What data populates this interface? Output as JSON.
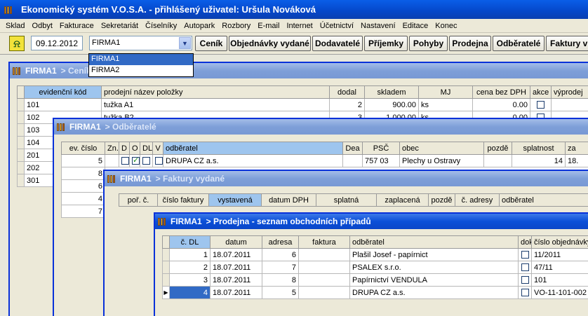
{
  "app": {
    "title": "Ekonomický systém V.O.S.A. - přihlášený uživatel: Uršula Nováková"
  },
  "menu": [
    "Sklad",
    "Odbyt",
    "Fakturace",
    "Sekretariát",
    "Číselníky",
    "Autopark",
    "Rozbory",
    "E-mail",
    "Internet",
    "Účetnictví",
    "Nastavení",
    "Editace",
    "Konec"
  ],
  "toolbar": {
    "date": "09.12.2012",
    "company_selected": "FIRMA1",
    "company_options": [
      "FIRMA1",
      "FIRMA2"
    ],
    "buttons": [
      "Ceník",
      "Objednávky vydané",
      "Dodavatelé",
      "Příjemky",
      "Pohyby",
      "Prodejna",
      "Odběratelé",
      "Faktury v"
    ]
  },
  "win_cenik": {
    "title": "FIRMA1",
    "crumb": "> Ceník",
    "columns": [
      "evidenční kód",
      "prodejní název položky",
      "dodal",
      "skladem",
      "MJ",
      "cena bez DPH",
      "akce",
      "výprodej"
    ],
    "rows": [
      {
        "code": "101",
        "name": "tužka A1",
        "dodal": "2",
        "skladem": "900.00",
        "mj": "ks",
        "cena": "0.00"
      },
      {
        "code": "102",
        "name": "tužka B2",
        "dodal": "3",
        "skladem": "1 000.00",
        "mj": "ks",
        "cena": "0.00"
      },
      {
        "code": "103"
      },
      {
        "code": "104"
      },
      {
        "code": "201"
      },
      {
        "code": "202"
      },
      {
        "code": "301"
      }
    ]
  },
  "win_odberatele": {
    "title": "FIRMA1",
    "crumb": "> Odběratelé",
    "columns": [
      "ev. číslo",
      "Zn.",
      "D",
      "O",
      "DL",
      "V",
      "odběratel",
      "Dea",
      "PSČ",
      "obec",
      "pozdě",
      "splatnost",
      "za"
    ],
    "rows": [
      {
        "ev": "5",
        "odberatel": "DRUPA CZ a.s.",
        "psc": "757 03",
        "obec": "Plechy u Ostravy",
        "splatnost": "14",
        "za": "18."
      },
      {
        "ev": "8"
      },
      {
        "ev": "6"
      },
      {
        "ev": "4"
      },
      {
        "ev": "7"
      }
    ]
  },
  "win_faktury": {
    "title": "FIRMA1",
    "crumb": "> Faktury vydané",
    "columns": [
      "poř. č.",
      "číslo faktury",
      "vystavená",
      "datum DPH",
      "splatná",
      "zaplacená",
      "pozdě",
      "č. adresy",
      "odběratel"
    ]
  },
  "win_prodejna": {
    "title": "FIRMA1",
    "crumb": "> Prodejna - seznam obchodních případů",
    "columns": [
      "č. DL",
      "datum",
      "adresa",
      "faktura",
      "odběratel",
      "dok",
      "číslo objednávky"
    ],
    "rows": [
      {
        "dl": "1",
        "datum": "18.07.2011",
        "adresa": "6",
        "odberatel": "Plašil Josef - papírnict",
        "obj": "11/2011"
      },
      {
        "dl": "2",
        "datum": "18.07.2011",
        "adresa": "7",
        "odberatel": "PSALEX s.r.o.",
        "obj": "47/11"
      },
      {
        "dl": "3",
        "datum": "18.07.2011",
        "adresa": "8",
        "odberatel": "Papírnictví VENDULA",
        "obj": "101"
      },
      {
        "dl": "4",
        "datum": "18.07.2011",
        "adresa": "5",
        "odberatel": "DRUPA CZ a.s.",
        "obj": "VO-11-101-002"
      }
    ]
  }
}
